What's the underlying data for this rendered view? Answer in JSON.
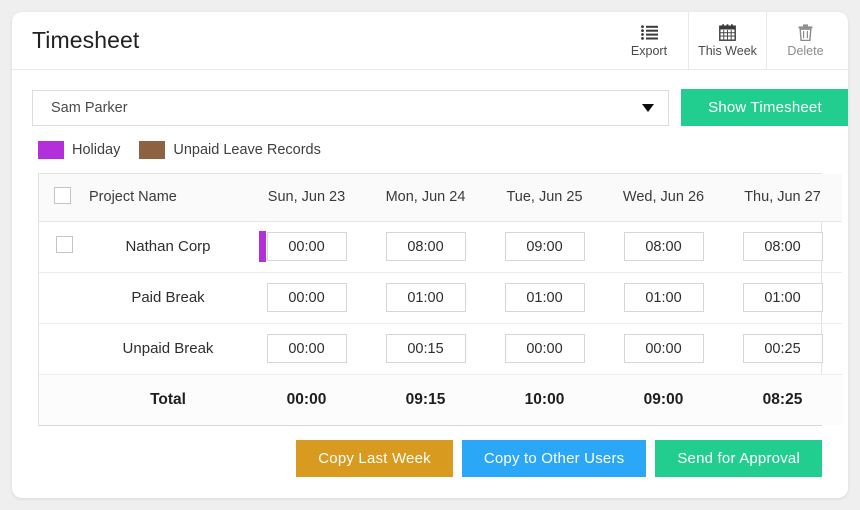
{
  "header": {
    "title": "Timesheet",
    "toolbar": [
      {
        "label": "Export",
        "icon": "list-icon",
        "muted": false
      },
      {
        "label": "This Week",
        "icon": "calendar-icon",
        "muted": false
      },
      {
        "label": "Delete",
        "icon": "trash-icon",
        "muted": true
      }
    ]
  },
  "selector": {
    "user_value": "Sam Parker",
    "caret_icon": "chevron-down-icon",
    "show_button": "Show Timesheet"
  },
  "legend": [
    {
      "label": "Holiday",
      "color": "#b32fd9"
    },
    {
      "label": "Unpaid Leave Records",
      "color": "#8c6241"
    }
  ],
  "table": {
    "columns": [
      "Project Name",
      "Sun, Jun 23",
      "Mon, Jun 24",
      "Tue, Jun 25",
      "Wed, Jun 26",
      "Thu, Jun 27"
    ],
    "rows": [
      {
        "name": "Nathan Corp",
        "has_checkbox": true,
        "values": [
          "00:00",
          "08:00",
          "09:00",
          "08:00",
          "08:00"
        ],
        "markers": [
          "#b32fd9",
          null,
          null,
          null,
          null
        ]
      },
      {
        "name": "Paid Break",
        "has_checkbox": false,
        "values": [
          "00:00",
          "01:00",
          "01:00",
          "01:00",
          "01:00"
        ],
        "markers": [
          null,
          null,
          null,
          null,
          null
        ]
      },
      {
        "name": "Unpaid Break",
        "has_checkbox": false,
        "values": [
          "00:00",
          "00:15",
          "00:00",
          "00:00",
          "00:25"
        ],
        "markers": [
          null,
          null,
          null,
          null,
          null
        ]
      }
    ],
    "total": {
      "label": "Total",
      "values": [
        "00:00",
        "09:15",
        "10:00",
        "09:00",
        "08:25"
      ]
    }
  },
  "actions": [
    {
      "label": "Copy Last Week",
      "color": "#d99a20"
    },
    {
      "label": "Copy to Other Users",
      "color": "#2ba7f7"
    },
    {
      "label": "Send for Approval",
      "color": "#21ce8f"
    }
  ]
}
